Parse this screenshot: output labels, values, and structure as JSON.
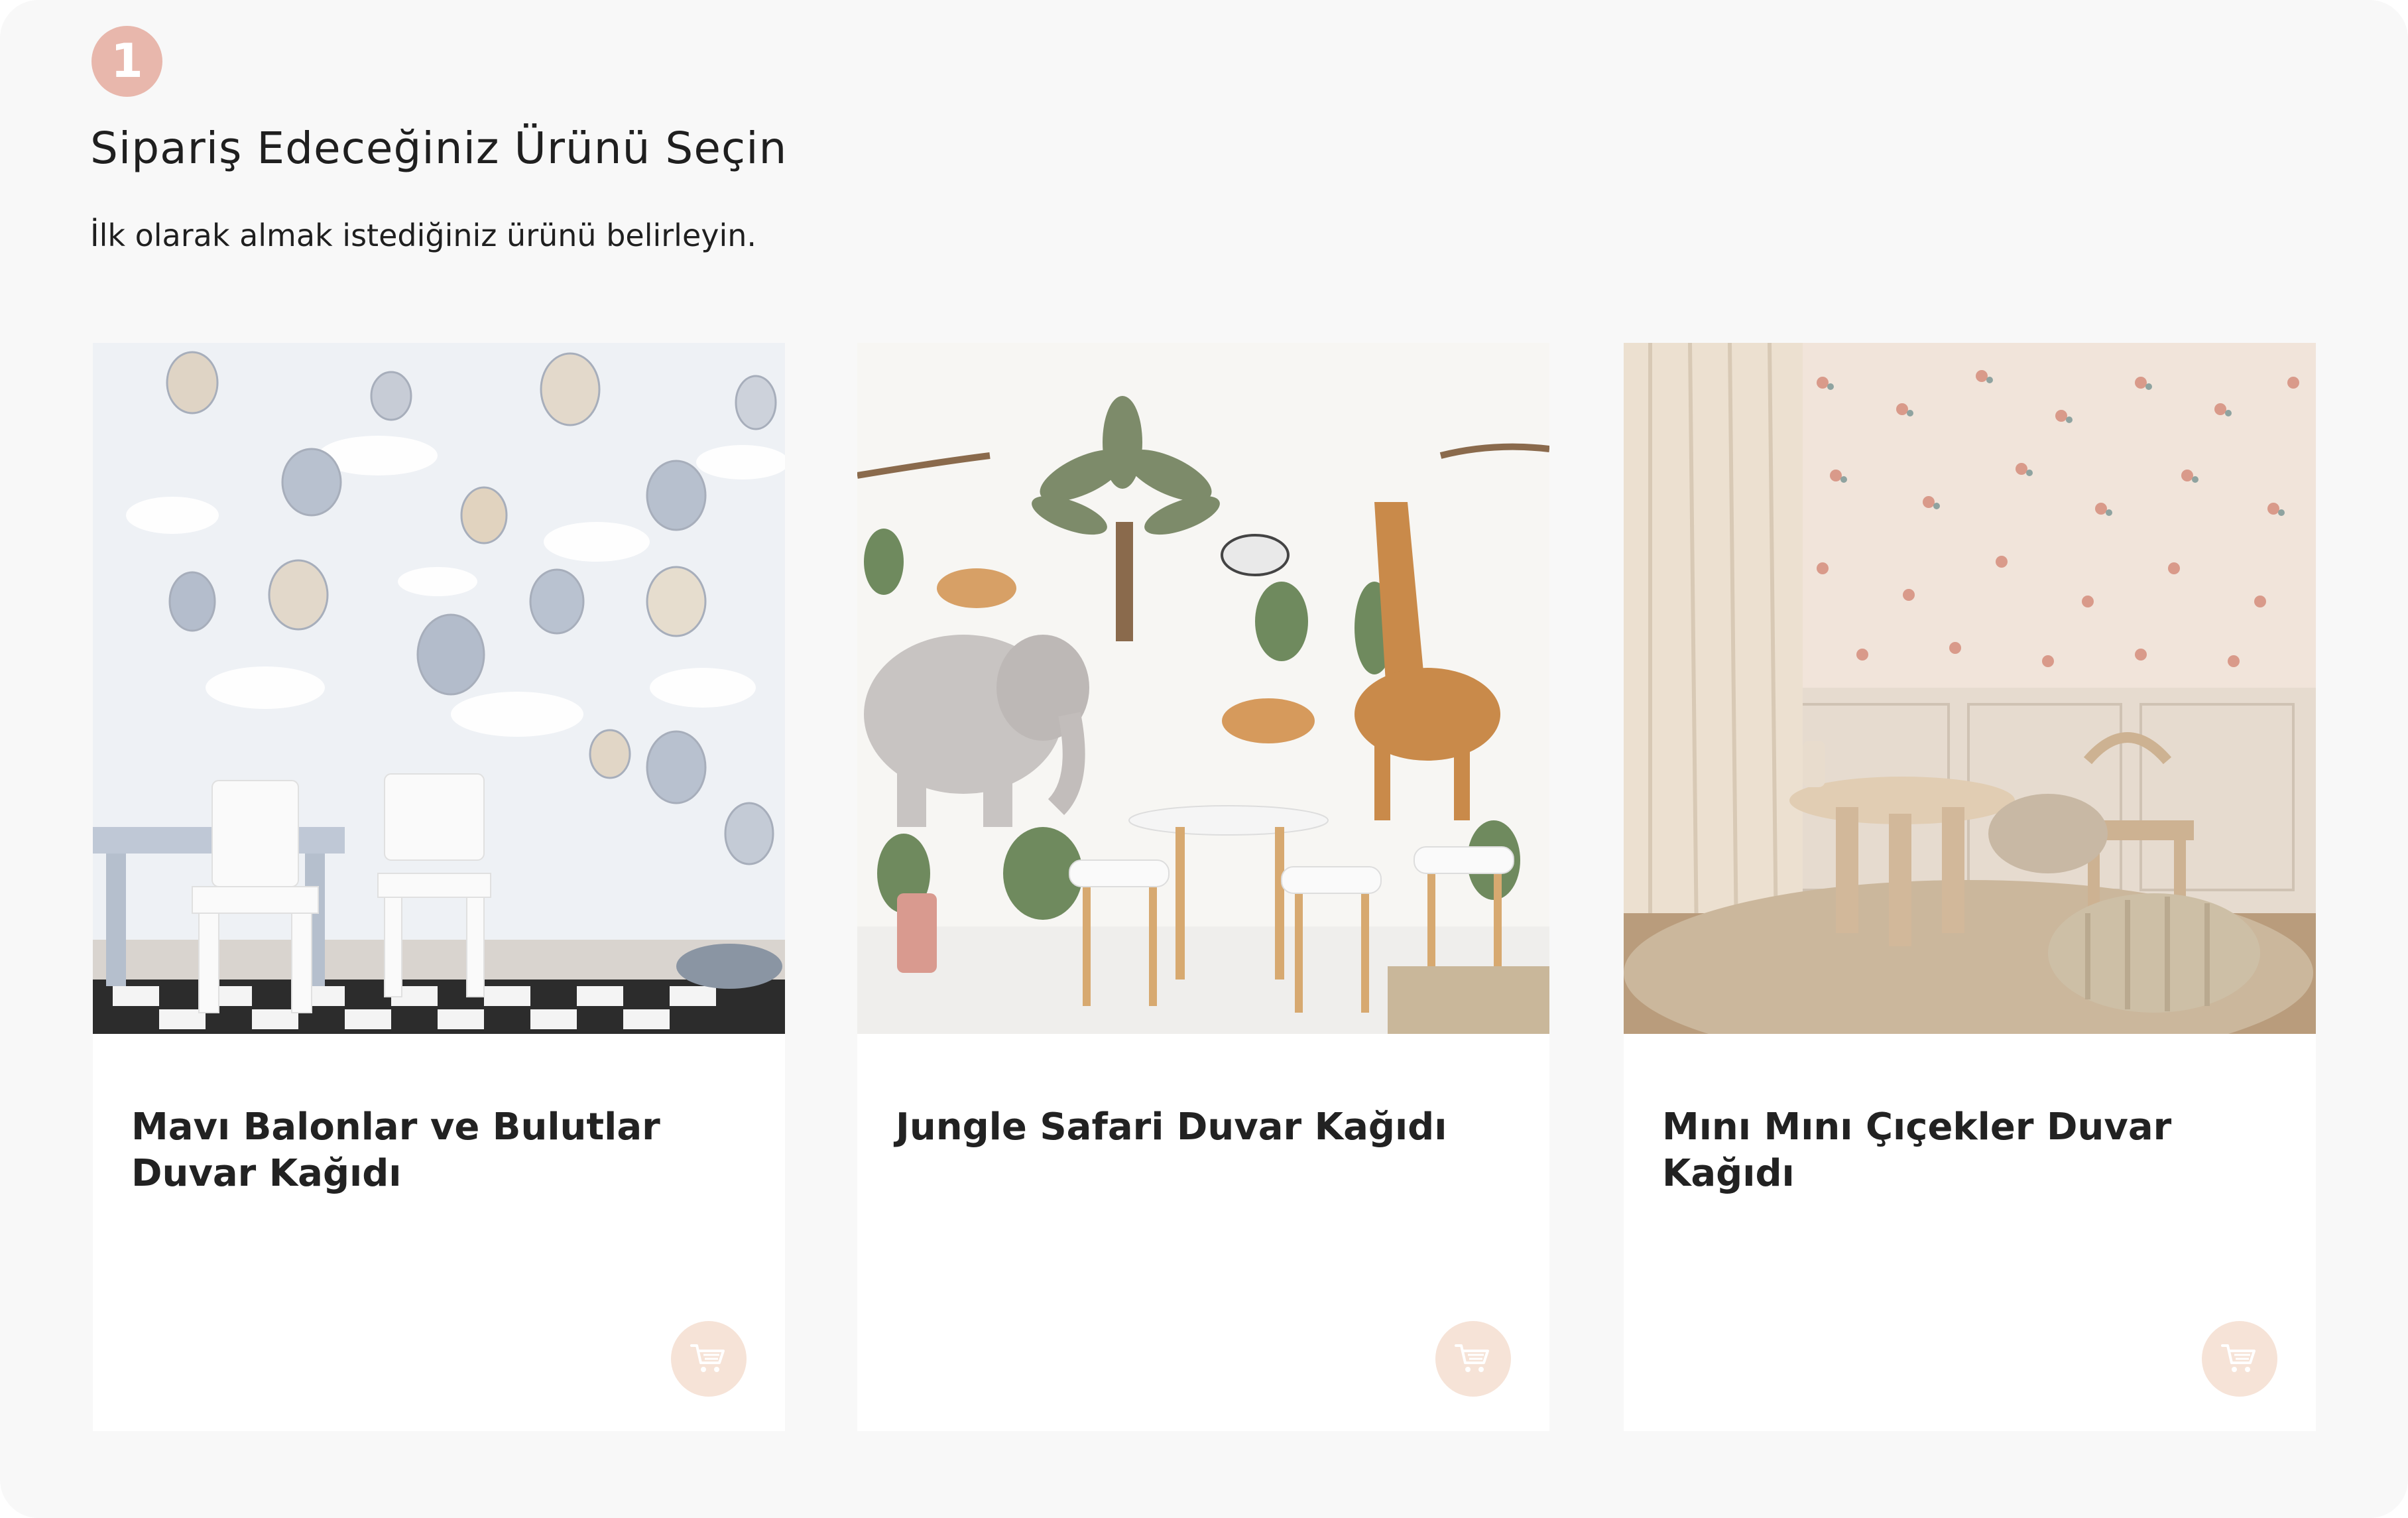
{
  "step": {
    "number": "1"
  },
  "header": {
    "title": "Sipariş Edeceğiniz Ürünü Seçin",
    "subtitle": "İlk olarak almak istediğiniz ürünü belirleyin."
  },
  "products": [
    {
      "title": "Mavı Balonlar ve Bulutlar Duvar Kağıdı",
      "image": "hot-air-balloons-clouds-wallpaper-room-photo",
      "action_icon": "shopping-cart-icon"
    },
    {
      "title": "Jungle Safari Duvar Kağıdı",
      "image": "jungle-safari-animals-wallpaper-room-photo",
      "action_icon": "shopping-cart-icon"
    },
    {
      "title": "Mını Mını Çıçekler Duvar Kağıdı",
      "image": "mini-flowers-wallpaper-room-photo",
      "action_icon": "shopping-cart-icon"
    }
  ],
  "colors": {
    "accent_badge": "#e8b7ac",
    "cart_button_bg": "#f6e3d7",
    "cart_icon": "#ffffff",
    "panel_bg": "#f8f8f8",
    "card_bg": "#ffffff"
  }
}
